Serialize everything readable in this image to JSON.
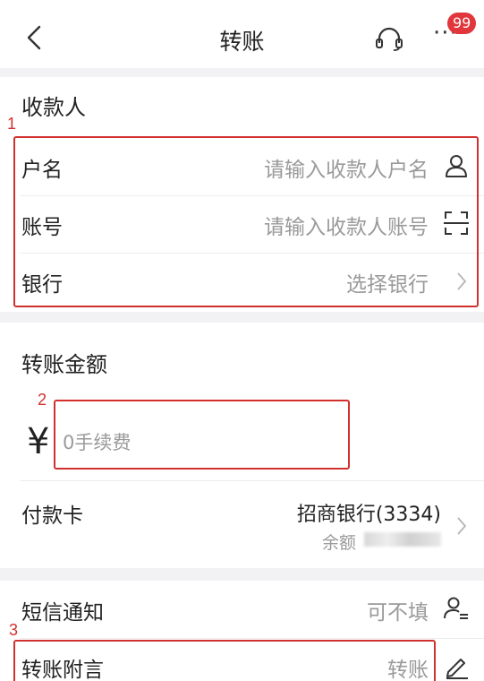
{
  "header": {
    "title": "转账",
    "back_icon": "chevron-left-icon",
    "service_icon": "headset-icon",
    "more_label": "···",
    "badge_count": "99"
  },
  "payee": {
    "section_title": "收款人",
    "marker": "1",
    "name_label": "户名",
    "name_placeholder": "请输入收款人户名",
    "account_label": "账号",
    "account_placeholder": "请输入收款人账号",
    "bank_label": "银行",
    "bank_placeholder": "选择银行"
  },
  "amount": {
    "section_title": "转账金额",
    "marker": "2",
    "currency": "¥",
    "placeholder": "0手续费"
  },
  "payment_card": {
    "label": "付款卡",
    "card_name": "招商银行(3334)",
    "balance_label": "余额"
  },
  "extras": {
    "sms_label": "短信通知",
    "sms_value": "可不填",
    "marker": "3",
    "note_label": "转账附言",
    "note_value": "转账"
  },
  "colors": {
    "accent_red": "#d0312f",
    "badge_red": "#e0363c",
    "hint_gray": "#9a9a9a"
  }
}
